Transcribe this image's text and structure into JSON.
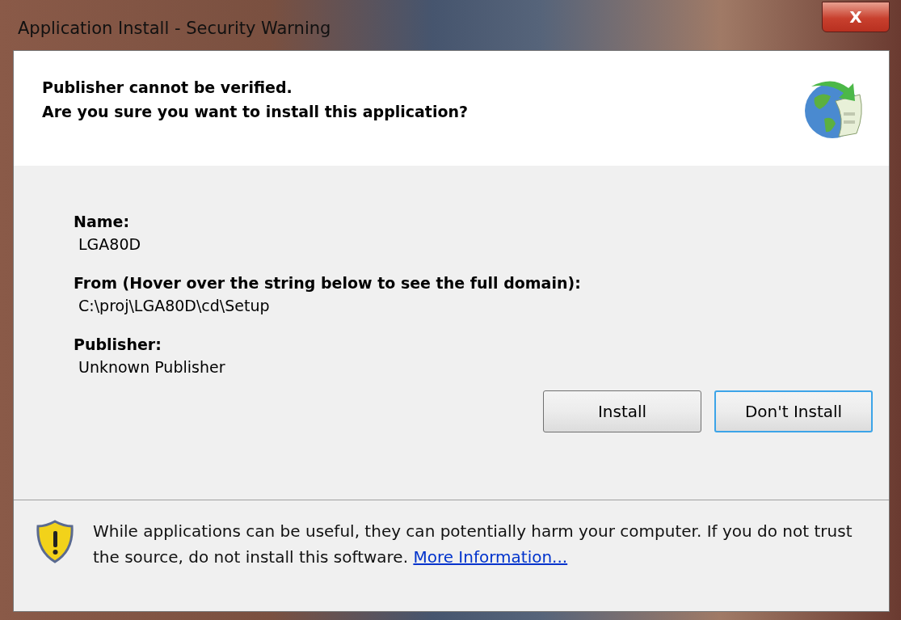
{
  "window": {
    "title": "Application Install - Security Warning",
    "close": "X"
  },
  "header": {
    "lines": [
      "Publisher cannot be verified.",
      "Are you sure you want to install this application?"
    ]
  },
  "fields": [
    {
      "label": "Name:",
      "value": "LGA80D"
    },
    {
      "label": "From (Hover over the string below to see the full domain):",
      "value": "C:\\proj\\LGA80D\\cd\\Setup"
    },
    {
      "label": "Publisher:",
      "value": "Unknown Publisher"
    }
  ],
  "buttons": [
    {
      "label": "Install",
      "focused": false
    },
    {
      "label": "Don't Install",
      "focused": true
    }
  ],
  "footer": {
    "text": "While applications can be useful, they can potentially harm your computer. If you do not trust the source, do not install this software.",
    "link": "More Information..."
  }
}
